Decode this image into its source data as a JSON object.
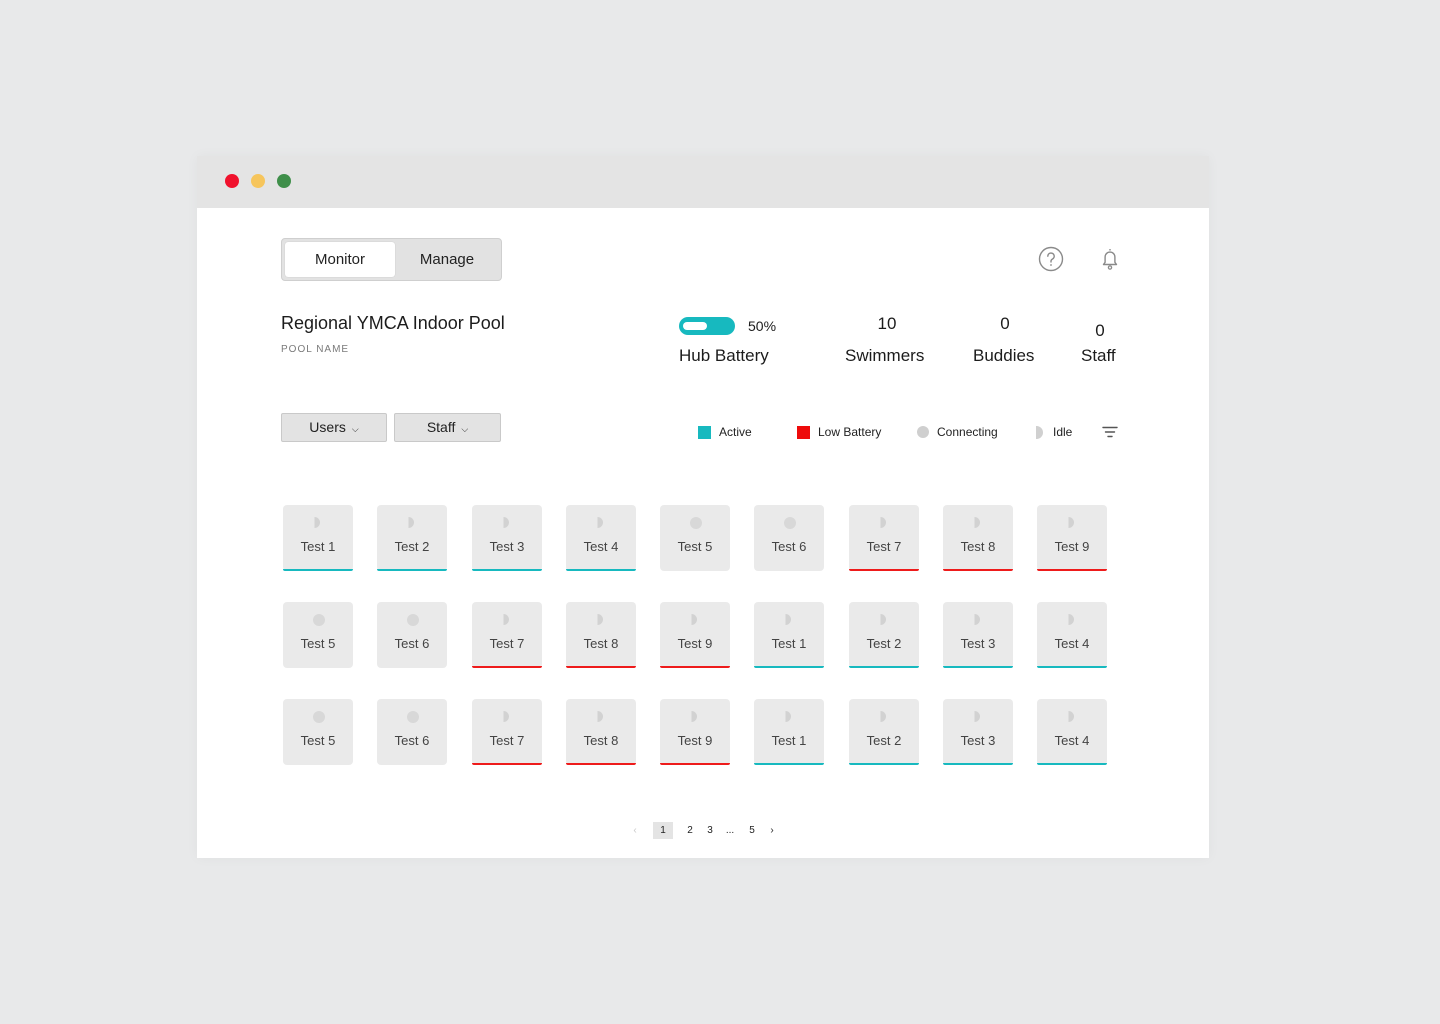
{
  "tabs": {
    "monitor": "Monitor",
    "manage": "Manage"
  },
  "pool": {
    "name": "Regional YMCA Indoor Pool",
    "caption": "POOL NAME"
  },
  "stats": {
    "battery_level": 0.5,
    "battery_percent": "50%",
    "battery_label": "Hub Battery",
    "swimmers_value": "10",
    "swimmers_label": "Swimmers",
    "buddies_value": "0",
    "buddies_label": "Buddies",
    "staff_value": "0",
    "staff_label": "Staff"
  },
  "filters": {
    "users": "Users",
    "staff": "Staff"
  },
  "legend": {
    "active": "Active",
    "low_battery": "Low Battery",
    "connecting": "Connecting",
    "idle": "Idle"
  },
  "colors": {
    "active": "#17b9bf",
    "low_battery": "#ee1b1b"
  },
  "devices": [
    [
      {
        "name": "Test 1",
        "status": "idle",
        "bar": "active"
      },
      {
        "name": "Test 2",
        "status": "idle",
        "bar": "active"
      },
      {
        "name": "Test 3",
        "status": "idle",
        "bar": "active"
      },
      {
        "name": "Test 4",
        "status": "idle",
        "bar": "active"
      },
      {
        "name": "Test 5",
        "status": "connecting",
        "bar": "none"
      },
      {
        "name": "Test 6",
        "status": "connecting",
        "bar": "none"
      },
      {
        "name": "Test 7",
        "status": "idle",
        "bar": "low_battery"
      },
      {
        "name": "Test 8",
        "status": "idle",
        "bar": "low_battery"
      },
      {
        "name": "Test 9",
        "status": "idle",
        "bar": "low_battery"
      }
    ],
    [
      {
        "name": "Test 5",
        "status": "connecting",
        "bar": "none"
      },
      {
        "name": "Test 6",
        "status": "connecting",
        "bar": "none"
      },
      {
        "name": "Test 7",
        "status": "idle",
        "bar": "low_battery"
      },
      {
        "name": "Test 8",
        "status": "idle",
        "bar": "low_battery"
      },
      {
        "name": "Test 9",
        "status": "idle",
        "bar": "low_battery"
      },
      {
        "name": "Test 1",
        "status": "idle",
        "bar": "active"
      },
      {
        "name": "Test 2",
        "status": "idle",
        "bar": "active"
      },
      {
        "name": "Test 3",
        "status": "idle",
        "bar": "active"
      },
      {
        "name": "Test 4",
        "status": "idle",
        "bar": "active"
      }
    ],
    [
      {
        "name": "Test 5",
        "status": "connecting",
        "bar": "none"
      },
      {
        "name": "Test 6",
        "status": "connecting",
        "bar": "none"
      },
      {
        "name": "Test 7",
        "status": "idle",
        "bar": "low_battery"
      },
      {
        "name": "Test 8",
        "status": "idle",
        "bar": "low_battery"
      },
      {
        "name": "Test 9",
        "status": "idle",
        "bar": "low_battery"
      },
      {
        "name": "Test 1",
        "status": "idle",
        "bar": "active"
      },
      {
        "name": "Test 2",
        "status": "idle",
        "bar": "active"
      },
      {
        "name": "Test 3",
        "status": "idle",
        "bar": "active"
      },
      {
        "name": "Test 4",
        "status": "idle",
        "bar": "active"
      }
    ]
  ],
  "pagination": {
    "prev": "‹",
    "pages": [
      "1",
      "2",
      "3",
      "...",
      "5"
    ],
    "next": "›",
    "current": "1"
  }
}
